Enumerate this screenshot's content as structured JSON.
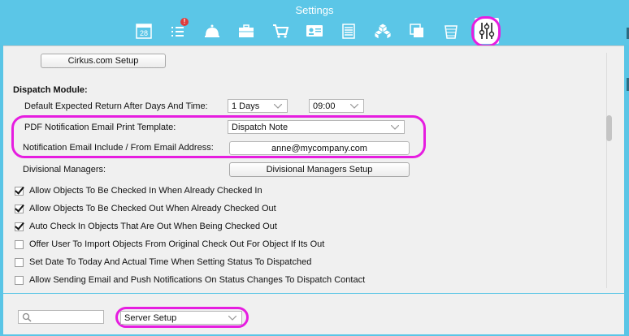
{
  "window": {
    "title": "Settings"
  },
  "toolbar": {
    "icons": [
      {
        "name": "calendar-icon",
        "text": "28"
      },
      {
        "name": "task-list-icon",
        "badge": "!"
      },
      {
        "name": "bell-icon"
      },
      {
        "name": "briefcase-icon"
      },
      {
        "name": "cart-icon"
      },
      {
        "name": "contact-card-icon"
      },
      {
        "name": "list-icon"
      },
      {
        "name": "boxes-icon"
      },
      {
        "name": "copy-icon"
      },
      {
        "name": "trash-icon"
      },
      {
        "name": "sliders-icon",
        "selected": true
      }
    ]
  },
  "content": {
    "cirkus_setup_button": "Cirkus.com Setup",
    "dispatch": {
      "heading": "Dispatch Module:",
      "return_label": "Default Expected Return After Days And Time:",
      "return_days": "1 Days",
      "return_time": "09:00",
      "pdf_template_label": "PDF Notification Email Print Template:",
      "pdf_template_value": "Dispatch Note",
      "notify_email_label": "Notification Email Include / From Email Address:",
      "notify_email_value": "anne@mycompany.com",
      "div_managers_label": "Divisional Managers:",
      "div_managers_button": "Divisional Managers Setup"
    },
    "checkboxes": [
      {
        "label": "Allow Objects To Be Checked In When Already Checked In",
        "checked": true
      },
      {
        "label": "Allow Objects To Be Checked Out When Already Checked Out",
        "checked": true
      },
      {
        "label": "Auto Check In Objects That Are Out When Being Checked Out",
        "checked": true
      },
      {
        "label": "Offer User To Import Objects From Original Check Out For Object If Its Out",
        "checked": false
      },
      {
        "label": "Set Date To Today And Actual Time When Setting Status To Dispatched",
        "checked": false
      },
      {
        "label": "Allow Sending Email and Push Notifications On Status Changes To Dispatch Contact",
        "checked": false
      }
    ]
  },
  "footer": {
    "search_placeholder": "",
    "section_select": "Server Setup"
  },
  "colors": {
    "title_bar": "#5bc6e7",
    "highlight": "#e61de0",
    "panel": "#f0f0f0"
  }
}
